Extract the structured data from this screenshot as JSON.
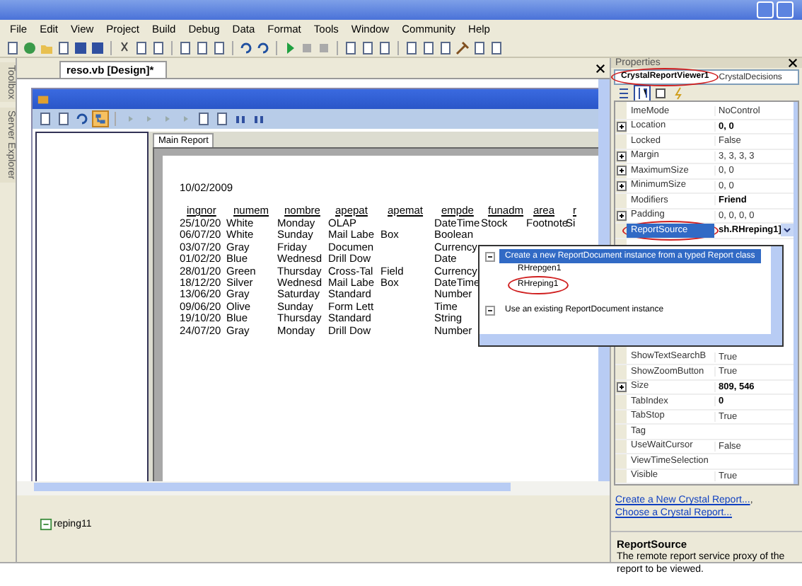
{
  "menu": [
    {
      "label": "File"
    },
    {
      "label": "Edit"
    },
    {
      "label": "View"
    },
    {
      "label": "Project"
    },
    {
      "label": "Build"
    },
    {
      "label": "Debug"
    },
    {
      "label": "Data"
    },
    {
      "label": "Format"
    },
    {
      "label": "Tools"
    },
    {
      "label": "Window"
    },
    {
      "label": "Community"
    },
    {
      "label": "Help"
    }
  ],
  "side_tabs": [
    {
      "label": "Toolbox"
    },
    {
      "label": "Server Explorer"
    }
  ],
  "document_tab": {
    "label": "reso.vb [Design]*",
    "selected": true
  },
  "viewer": {
    "report_tab": {
      "label": "Main Report",
      "selected": true
    },
    "report": {
      "date": "10/02/2009",
      "columns": [
        "ingnor",
        "numem",
        "nombre",
        "apepat",
        "apemat",
        "empde",
        "funadm",
        "area",
        "r"
      ],
      "rows": [
        [
          "25/10/20",
          "White",
          "Monday",
          "OLAP",
          null,
          "DateTime",
          "Stock",
          "Footnote",
          "Si"
        ],
        [
          "06/07/20",
          "White",
          "Sunday",
          "Mail Labe",
          "Box",
          "Boolean",
          null,
          null,
          null
        ],
        [
          "03/07/20",
          "Gray",
          "Friday",
          "Documen",
          null,
          "Currency",
          null,
          null,
          null
        ],
        [
          "01/02/20",
          "Blue",
          "Wednesd",
          "Drill Dow",
          null,
          "Date",
          null,
          null,
          null
        ],
        [
          "28/01/20",
          "Green",
          "Thursday",
          "Cross-Tal",
          "Field",
          "Currency",
          null,
          null,
          null
        ],
        [
          "18/12/20",
          "Silver",
          "Wednesd",
          "Mail Labe",
          "Box",
          "DateTime",
          null,
          null,
          null
        ],
        [
          "13/06/20",
          "Gray",
          "Saturday",
          "Standard",
          null,
          "Number",
          null,
          null,
          null
        ],
        [
          "09/06/20",
          "Olive",
          "Sunday",
          "Form Lett",
          null,
          "Time",
          null,
          null,
          null
        ],
        [
          "19/10/20",
          "Blue",
          "Thursday",
          "Standard",
          null,
          "String",
          null,
          null,
          null
        ],
        [
          "24/07/20",
          "Gray",
          "Monday",
          "Drill Dow",
          null,
          "Number",
          null,
          null,
          null
        ]
      ]
    }
  },
  "tray": [
    {
      "label": "reping11"
    }
  ],
  "properties": {
    "title": "Properties",
    "object": {
      "name": "CrystalReportViewer1",
      "type": "CrystalDecisions",
      "circled": true
    },
    "rows": [
      {
        "name": "ImeMode",
        "value": "NoControl",
        "bold": false,
        "expandable": false,
        "selected": false,
        "circled": false
      },
      {
        "name": "Location",
        "value": "0, 0",
        "bold": true,
        "expandable": true,
        "selected": false,
        "circled": false
      },
      {
        "name": "Locked",
        "value": "False",
        "bold": false,
        "expandable": false,
        "selected": false,
        "circled": false
      },
      {
        "name": "Margin",
        "value": "3, 3, 3, 3",
        "bold": false,
        "expandable": true,
        "selected": false,
        "circled": false
      },
      {
        "name": "MaximumSize",
        "value": "0, 0",
        "bold": false,
        "expandable": true,
        "selected": false,
        "circled": false
      },
      {
        "name": "MinimumSize",
        "value": "0, 0",
        "bold": false,
        "expandable": true,
        "selected": false,
        "circled": false
      },
      {
        "name": "Modifiers",
        "value": "Friend",
        "bold": true,
        "expandable": false,
        "selected": false,
        "circled": false
      },
      {
        "name": "Padding",
        "value": "0, 0, 0, 0",
        "bold": false,
        "expandable": true,
        "selected": false,
        "circled": false
      },
      {
        "name": "ReportSource",
        "value": "sh.RHreping1]",
        "bold": true,
        "expandable": false,
        "selected": true,
        "circled": true
      }
    ],
    "popup": [
      {
        "label": "Create a new ReportDocument instance from a typed Report class",
        "selected": true,
        "expanded": true,
        "children": [
          {
            "label": "RHrepgen1",
            "selected": false,
            "circled": false
          },
          {
            "label": "RHreping1",
            "selected": false,
            "circled": true
          }
        ]
      },
      {
        "label": "Use an existing ReportDocument instance",
        "selected": false,
        "expanded": true
      }
    ],
    "rows_below": [
      {
        "name": "ShowTextSearchB",
        "value": "True",
        "bold": false,
        "expandable": false,
        "selected": false,
        "circled": false
      },
      {
        "name": "ShowZoomButton",
        "value": "True",
        "bold": false,
        "expandable": false,
        "selected": false,
        "circled": false
      },
      {
        "name": "Size",
        "value": "809, 546",
        "bold": true,
        "expandable": true,
        "selected": false,
        "circled": false
      },
      {
        "name": "TabIndex",
        "value": "0",
        "bold": true,
        "expandable": false,
        "selected": false,
        "circled": false
      },
      {
        "name": "TabStop",
        "value": "True",
        "bold": false,
        "expandable": false,
        "selected": false,
        "circled": false
      },
      {
        "name": "Tag",
        "expandable": false,
        "selected": false,
        "circled": false
      },
      {
        "name": "UseWaitCursor",
        "value": "False",
        "bold": false,
        "expandable": false,
        "selected": false,
        "circled": false
      },
      {
        "name": "ViewTimeSelection",
        "expandable": false,
        "selected": false,
        "circled": false
      },
      {
        "name": "Visible",
        "value": "True",
        "bold": false,
        "expandable": false,
        "selected": false,
        "circled": false
      }
    ],
    "links": [
      "Create a New Crystal Report...",
      "Choose a Crystal Report..."
    ],
    "link_separator": ",",
    "description": {
      "title": "ReportSource",
      "text": "The remote report service proxy of the report to be viewed."
    }
  }
}
